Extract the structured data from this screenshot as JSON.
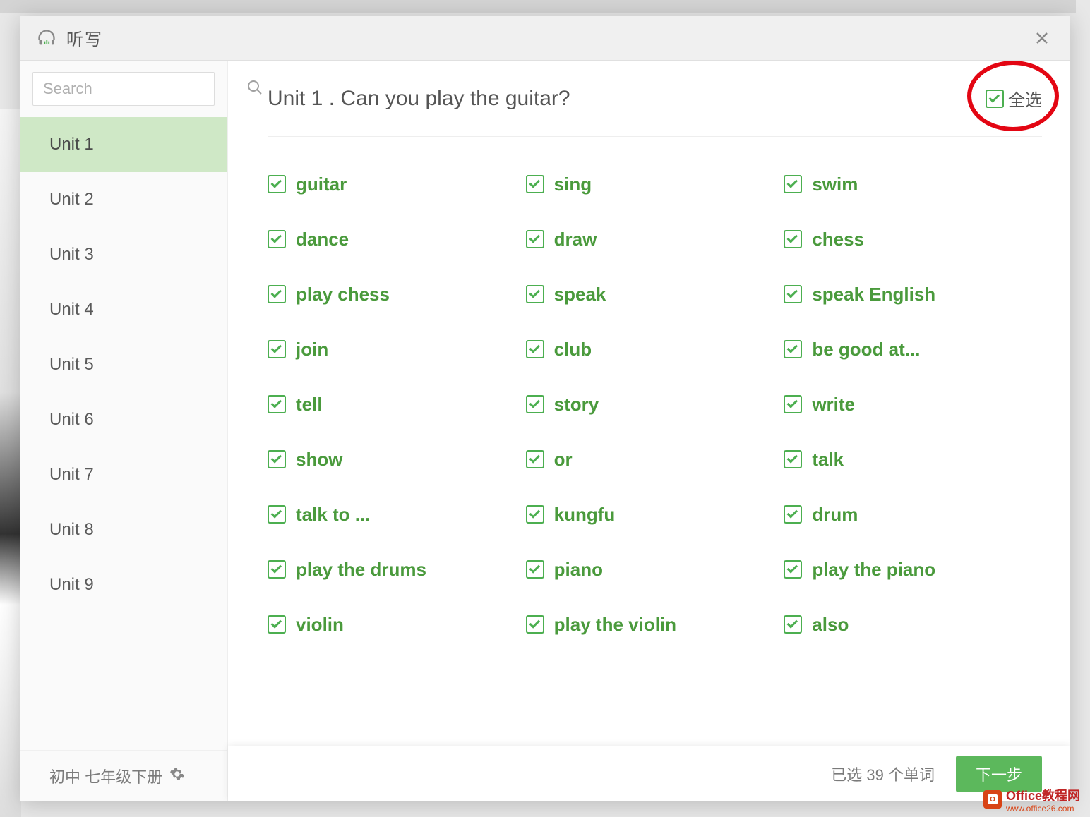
{
  "header": {
    "title": "听写"
  },
  "search": {
    "placeholder": "Search"
  },
  "sidebar": {
    "items": [
      {
        "label": "Unit 1",
        "active": true
      },
      {
        "label": "Unit 2",
        "active": false
      },
      {
        "label": "Unit 3",
        "active": false
      },
      {
        "label": "Unit 4",
        "active": false
      },
      {
        "label": "Unit 5",
        "active": false
      },
      {
        "label": "Unit 6",
        "active": false
      },
      {
        "label": "Unit 7",
        "active": false
      },
      {
        "label": "Unit 8",
        "active": false
      },
      {
        "label": "Unit 9",
        "active": false
      }
    ],
    "footer_label": "初中 七年级下册"
  },
  "main": {
    "heading": "Unit 1 . Can you play the guitar?",
    "select_all_label": "全选",
    "words": [
      [
        "guitar",
        "sing",
        "swim"
      ],
      [
        "dance",
        "draw",
        "chess"
      ],
      [
        "play chess",
        "speak",
        "speak English"
      ],
      [
        "join",
        "club",
        "be good at..."
      ],
      [
        "tell",
        "story",
        "write"
      ],
      [
        "show",
        "or",
        "talk"
      ],
      [
        "talk to ...",
        "kungfu",
        "drum"
      ],
      [
        "play the drums",
        "piano",
        "play the piano"
      ],
      [
        "violin",
        "play the violin",
        "also"
      ]
    ]
  },
  "footer": {
    "count_text": "已选 39 个单词",
    "next_label": "下一步"
  },
  "watermark": {
    "badge_letter": "O",
    "line1": "Office教程网",
    "line2": "www.office26.com"
  }
}
